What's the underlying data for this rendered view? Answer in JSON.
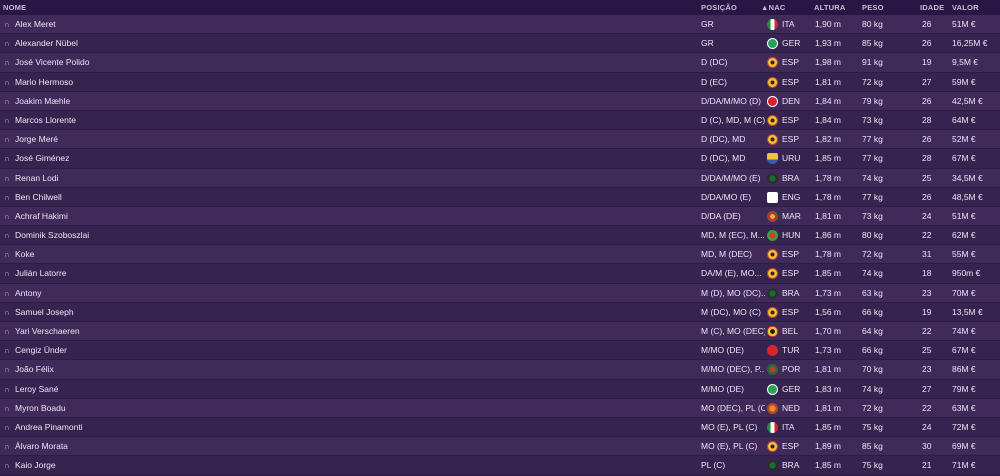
{
  "columns": {
    "nome": "NOME",
    "posicao": "POSIÇÃO",
    "nac": "▲NAC",
    "altura": "ALTURA",
    "peso": "PESO",
    "idade": "IDADE",
    "valor": "VALOR"
  },
  "pin_icon": "∩",
  "players": [
    {
      "name": "Alex Meret",
      "pos": "GR",
      "nat": "ITA",
      "altura": "1,90 m",
      "peso": "80 kg",
      "idade": "26",
      "valor": "51M €"
    },
    {
      "name": "Alexander Nübel",
      "pos": "GR",
      "nat": "GER",
      "altura": "1,93 m",
      "peso": "85 kg",
      "idade": "26",
      "valor": "16,25M €"
    },
    {
      "name": "José Vicente Polido",
      "pos": "D (DC)",
      "nat": "ESP",
      "altura": "1,98 m",
      "peso": "91 kg",
      "idade": "19",
      "valor": "9,5M €"
    },
    {
      "name": "Mario Hermoso",
      "pos": "D (EC)",
      "nat": "ESP",
      "altura": "1,81 m",
      "peso": "72 kg",
      "idade": "27",
      "valor": "59M €"
    },
    {
      "name": "Joakim Mæhle",
      "pos": "D/DA/M/MO (D)",
      "nat": "DEN",
      "altura": "1,84 m",
      "peso": "79 kg",
      "idade": "26",
      "valor": "42,5M €"
    },
    {
      "name": "Marcos Llorente",
      "pos": "D (C), MD, M (C)",
      "nat": "ESP",
      "altura": "1,84 m",
      "peso": "73 kg",
      "idade": "28",
      "valor": "64M €"
    },
    {
      "name": "Jorge Meré",
      "pos": "D (DC), MD",
      "nat": "ESP",
      "altura": "1,82 m",
      "peso": "77 kg",
      "idade": "26",
      "valor": "52M €"
    },
    {
      "name": "José Giménez",
      "pos": "D (DC), MD",
      "nat": "URU",
      "altura": "1,85 m",
      "peso": "77 kg",
      "idade": "28",
      "valor": "67M €"
    },
    {
      "name": "Renan Lodi",
      "pos": "D/DA/M/MO (E)",
      "nat": "BRA",
      "altura": "1,78 m",
      "peso": "74 kg",
      "idade": "25",
      "valor": "34,5M €"
    },
    {
      "name": "Ben Chilwell",
      "pos": "D/DA/MO (E)",
      "nat": "ENG",
      "altura": "1,78 m",
      "peso": "77 kg",
      "idade": "26",
      "valor": "48,5M €"
    },
    {
      "name": "Achraf Hakimi",
      "pos": "D/DA (DE)",
      "nat": "MAR",
      "altura": "1,81 m",
      "peso": "73 kg",
      "idade": "24",
      "valor": "51M €"
    },
    {
      "name": "Dominik Szoboszlai",
      "pos": "MD, M (EC), M...",
      "nat": "HUN",
      "altura": "1,86 m",
      "peso": "80 kg",
      "idade": "22",
      "valor": "62M €"
    },
    {
      "name": "Koke",
      "pos": "MD, M (DEC)",
      "nat": "ESP",
      "altura": "1,78 m",
      "peso": "72 kg",
      "idade": "31",
      "valor": "55M €"
    },
    {
      "name": "Julián Latorre",
      "pos": "DA/M (E), MO...",
      "nat": "ESP",
      "altura": "1,85 m",
      "peso": "74 kg",
      "idade": "18",
      "valor": "950m €"
    },
    {
      "name": "Antony",
      "pos": "M (D), MO (DC)...",
      "nat": "BRA",
      "altura": "1,73 m",
      "peso": "63 kg",
      "idade": "23",
      "valor": "70M €"
    },
    {
      "name": "Samuel Joseph",
      "pos": "M (DC), MO (C)",
      "nat": "ESP",
      "altura": "1,56 m",
      "peso": "66 kg",
      "idade": "19",
      "valor": "13,5M €"
    },
    {
      "name": "Yari Verschaeren",
      "pos": "M (C), MO (DEC)",
      "nat": "BEL",
      "altura": "1,70 m",
      "peso": "64 kg",
      "idade": "22",
      "valor": "74M €"
    },
    {
      "name": "Cengiz Ünder",
      "pos": "M/MO (DE)",
      "nat": "TUR",
      "altura": "1,73 m",
      "peso": "66 kg",
      "idade": "25",
      "valor": "67M €"
    },
    {
      "name": "João Félix",
      "pos": "M/MO (DEC), P...",
      "nat": "POR",
      "altura": "1,81 m",
      "peso": "70 kg",
      "idade": "23",
      "valor": "86M €"
    },
    {
      "name": "Leroy Sané",
      "pos": "M/MO (DE)",
      "nat": "GER",
      "altura": "1,83 m",
      "peso": "74 kg",
      "idade": "27",
      "valor": "79M €"
    },
    {
      "name": "Myron Boadu",
      "pos": "MO (DEC), PL (C)",
      "nat": "NED",
      "altura": "1,81 m",
      "peso": "72 kg",
      "idade": "22",
      "valor": "63M €"
    },
    {
      "name": "Andrea Pinamonti",
      "pos": "MO (E), PL (C)",
      "nat": "ITA",
      "altura": "1,85 m",
      "peso": "75 kg",
      "idade": "24",
      "valor": "72M €"
    },
    {
      "name": "Álvaro Morata",
      "pos": "MO (E), PL (C)",
      "nat": "ESP",
      "altura": "1,89 m",
      "peso": "85 kg",
      "idade": "30",
      "valor": "69M €"
    },
    {
      "name": "Kaio Jorge",
      "pos": "PL (C)",
      "nat": "BRA",
      "altura": "1,85 m",
      "peso": "75 kg",
      "idade": "21",
      "valor": "71M €"
    }
  ]
}
